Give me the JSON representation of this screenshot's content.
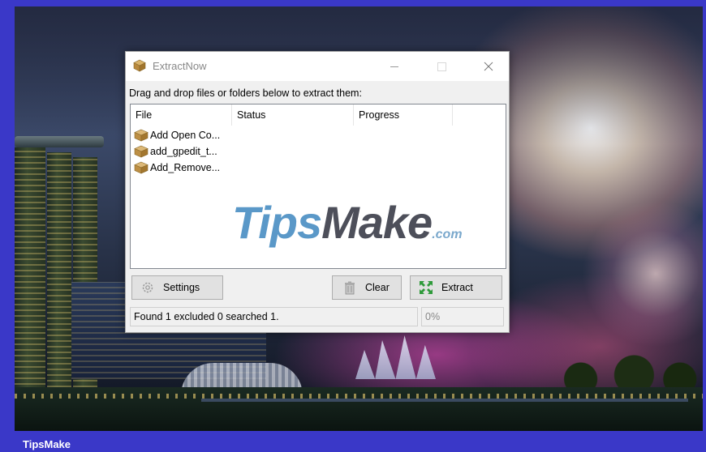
{
  "window": {
    "title": "ExtractNow",
    "instructions": "Drag and drop files or folders below to extract them:",
    "columns": [
      "File",
      "Status",
      "Progress"
    ],
    "files": [
      {
        "name": "Add Open Co...",
        "icon": "archive-box-icon"
      },
      {
        "name": "add_gpedit_t...",
        "icon": "archive-box-icon"
      },
      {
        "name": "Add_Remove...",
        "icon": "archive-box-icon"
      }
    ],
    "buttons": {
      "settings": "Settings",
      "clear": "Clear",
      "extract": "Extract"
    },
    "status_text": "Found 1 excluded 0 searched 1.",
    "progress_text": "0%"
  },
  "watermark": {
    "tips": "Tips",
    "make": "Make",
    "com": ".com"
  },
  "caption": "TipsMake",
  "colors": {
    "frame": "#3a38c8",
    "watermark_blue": "#5a98c8",
    "watermark_dark": "#4d4f5a"
  }
}
